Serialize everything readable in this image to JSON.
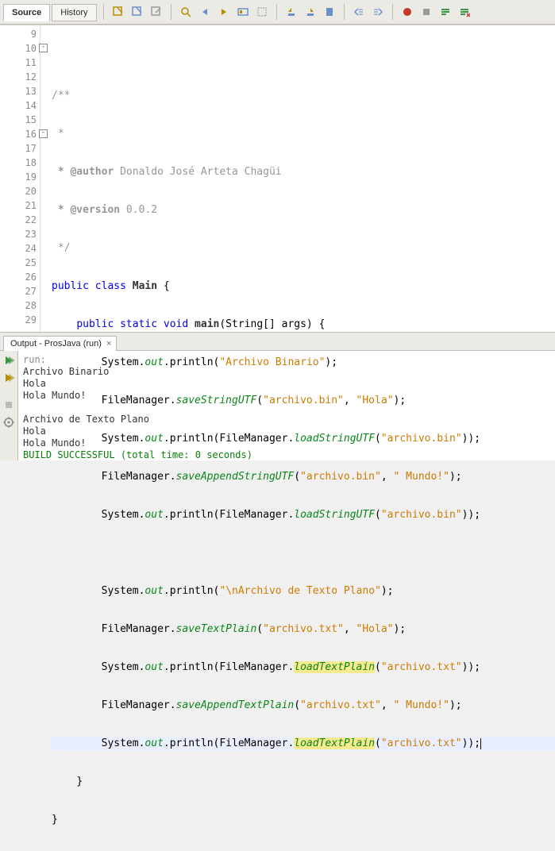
{
  "toolbar": {
    "tabs": [
      {
        "label": "Source",
        "active": true
      },
      {
        "label": "History",
        "active": false
      }
    ]
  },
  "gutter": {
    "start": 9,
    "end": 29,
    "folds": [
      10,
      16
    ]
  },
  "code": {
    "comment_open": "/**",
    "comment_star": " *",
    "author_tag": " * @author",
    "author_name": " Donaldo José Arteta Chagüi",
    "version_tag": " * @version",
    "version_val": " 0.0.2",
    "comment_close": " */",
    "kw_public": "public",
    "kw_class": "class",
    "kw_static": "static",
    "kw_void": "void",
    "class_name": "Main",
    "method_main": "main",
    "main_args": "(String[] args) {",
    "brace_open": " {",
    "brace_close": "}",
    "system": "System.",
    "out": "out",
    "println": ".println(",
    "fm": "FileManager.",
    "saveStringUTF": "saveStringUTF",
    "loadStringUTF": "loadStringUTF",
    "saveAppendStringUTF": "saveAppendStringUTF",
    "saveTextPlain": "saveTextPlain",
    "loadTextPlain": "loadTextPlain",
    "saveAppendTextPlain": "saveAppendTextPlain",
    "str_archivo_bin_title": "\"Archivo Binario\"",
    "str_archivo_bin": "\"archivo.bin\"",
    "str_hola": "\"Hola\"",
    "str_mundo": "\" Mundo!\"",
    "str_texto_plano_title": "\"\\nArchivo de Texto Plano\"",
    "str_archivo_txt": "\"archivo.txt\"",
    "paren_close_semi": ");",
    "paren2_close_semi": "));",
    "comma_sp": ", "
  },
  "output": {
    "tab_label": "Output - ProsJava (run)",
    "lines": [
      {
        "text": "run:",
        "cls": "out-gray"
      },
      {
        "text": "Archivo Binario",
        "cls": ""
      },
      {
        "text": "Hola",
        "cls": ""
      },
      {
        "text": "Hola Mundo!",
        "cls": ""
      },
      {
        "text": "",
        "cls": ""
      },
      {
        "text": "Archivo de Texto Plano",
        "cls": ""
      },
      {
        "text": "Hola",
        "cls": ""
      },
      {
        "text": "Hola Mundo!",
        "cls": ""
      },
      {
        "text": "BUILD SUCCESSFUL (total time: 0 seconds)",
        "cls": "out-green"
      }
    ]
  }
}
